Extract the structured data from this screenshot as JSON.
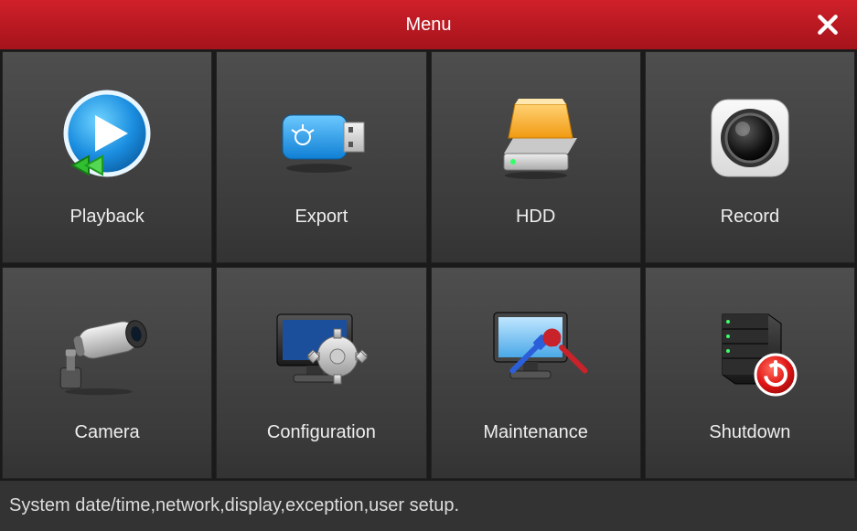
{
  "header": {
    "title": "Menu"
  },
  "tiles": [
    {
      "id": "playback",
      "label": "Playback"
    },
    {
      "id": "export",
      "label": "Export"
    },
    {
      "id": "hdd",
      "label": "HDD"
    },
    {
      "id": "record",
      "label": "Record"
    },
    {
      "id": "camera",
      "label": "Camera"
    },
    {
      "id": "configuration",
      "label": "Configuration"
    },
    {
      "id": "maintenance",
      "label": "Maintenance"
    },
    {
      "id": "shutdown",
      "label": "Shutdown"
    }
  ],
  "footer": {
    "hint": "System date/time,network,display,exception,user setup."
  }
}
